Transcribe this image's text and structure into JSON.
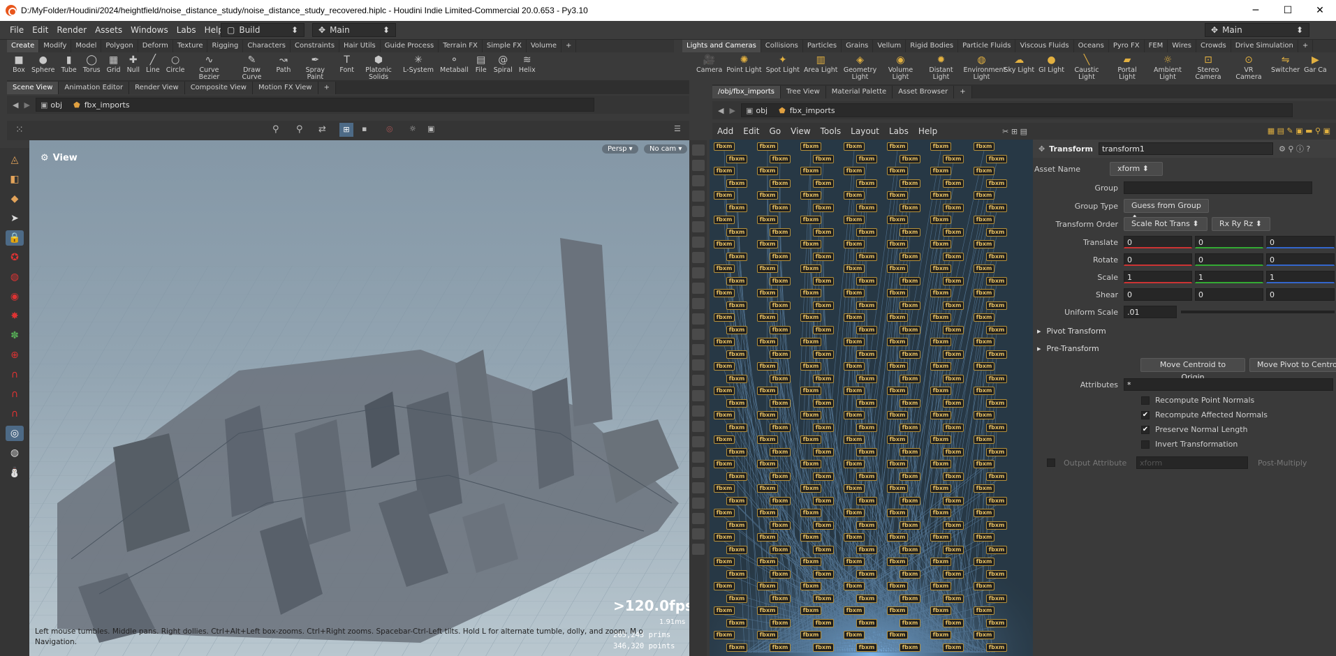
{
  "window": {
    "title": "D:/MyFolder/Houdini/2024/heightfield/noise_distance_study/noise_distance_study_recovered.hiplc - Houdini Indie Limited-Commercial 20.0.653 - Py3.10",
    "min": "─",
    "max": "☐",
    "close": "✕"
  },
  "menu": [
    "File",
    "Edit",
    "Render",
    "Assets",
    "Windows",
    "Labs",
    "Help"
  ],
  "desktop": "Build",
  "main_left": "Main",
  "main_right": "Main",
  "shelf_left_tabs": [
    "Create",
    "Modify",
    "Model",
    "Polygon",
    "Deform",
    "Texture",
    "Rigging",
    "Characters",
    "Constraints",
    "Hair Utils",
    "Guide Process",
    "Terrain FX",
    "Simple FX",
    "Volume",
    "+"
  ],
  "shelf_left_tools": [
    [
      "Box",
      "■"
    ],
    [
      "Sphere",
      "●"
    ],
    [
      "Tube",
      "▮"
    ],
    [
      "Torus",
      "◯"
    ],
    [
      "Grid",
      "▦"
    ],
    [
      "Null",
      "✚"
    ],
    [
      "Line",
      "╱"
    ],
    [
      "Circle",
      "○"
    ],
    [
      "Curve Bezier",
      "∿"
    ],
    [
      "Draw Curve",
      "✎"
    ],
    [
      "Path",
      "↝"
    ],
    [
      "Spray Paint",
      "✒"
    ],
    [
      "Font",
      "T"
    ],
    [
      "Platonic Solids",
      "⬢"
    ],
    [
      "L-System",
      "✳"
    ],
    [
      "Metaball",
      "⚬"
    ],
    [
      "File",
      "▤"
    ],
    [
      "Spiral",
      "@"
    ],
    [
      "Helix",
      "≋"
    ]
  ],
  "shelf_right_tabs": [
    "Lights and Cameras",
    "Collisions",
    "Particles",
    "Grains",
    "Vellum",
    "Rigid Bodies",
    "Particle Fluids",
    "Viscous Fluids",
    "Oceans",
    "Pyro FX",
    "FEM",
    "Wires",
    "Crowds",
    "Drive Simulation",
    "+"
  ],
  "shelf_right_tools": [
    [
      "Camera",
      "🎥"
    ],
    [
      "Point Light",
      "✺"
    ],
    [
      "Spot Light",
      "✦"
    ],
    [
      "Area Light",
      "▥"
    ],
    [
      "Geometry Light",
      "◈"
    ],
    [
      "Volume Light",
      "◉"
    ],
    [
      "Distant Light",
      "✹"
    ],
    [
      "Environment Light",
      "◍"
    ],
    [
      "Sky Light",
      "☁"
    ],
    [
      "GI Light",
      "●"
    ],
    [
      "Caustic Light",
      "╲"
    ],
    [
      "Portal Light",
      "▰"
    ],
    [
      "Ambient Light",
      "☼"
    ],
    [
      "Stereo Camera",
      "⊡"
    ],
    [
      "VR Camera",
      "⊙"
    ],
    [
      "Switcher",
      "⇋"
    ],
    [
      "Gar Ca",
      "▶"
    ]
  ],
  "left_pane_tabs": [
    "Scene View",
    "Animation Editor",
    "Render View",
    "Composite View",
    "Motion FX View",
    "+"
  ],
  "right_pane_tabs": [
    "/obj/fbx_imports",
    "Tree View",
    "Material Palette",
    "Asset Browser",
    "+"
  ],
  "path_obj": "obj",
  "path_node": "fbx_imports",
  "viewport": {
    "name": "View",
    "persp": "Persp",
    "cam": "No cam",
    "fps": ">120.0fps",
    "ms": "1.91ms",
    "prims": "265,243  prims",
    "points": "346,320 points",
    "help": "Left mouse tumbles. Middle pans. Right dollies. Ctrl+Alt+Left box-zooms. Ctrl+Right zooms. Spacebar-Ctrl-Left tilts. Hold L for alternate tumble, dolly, and zoom. M or Alt+M for First Person",
    "help2": "Navigation."
  },
  "net_menu": [
    "Add",
    "Edit",
    "Go",
    "View",
    "Tools",
    "Layout",
    "Labs",
    "Help"
  ],
  "node_label": "fbxm",
  "params": {
    "type": "Transform",
    "name": "transform1",
    "asset_label": "Asset Name",
    "asset": "xform",
    "group_label": "Group",
    "group": "",
    "grouptype_label": "Group Type",
    "grouptype": "Guess from Group",
    "order_label": "Transform Order",
    "order": "Scale Rot Trans",
    "rot_order": "Rx Ry Rz",
    "translate_label": "Translate",
    "translate": [
      "0",
      "0",
      "0"
    ],
    "rotate_label": "Rotate",
    "rotate": [
      "0",
      "0",
      "0"
    ],
    "scale_label": "Scale",
    "scale": [
      "1",
      "1",
      "1"
    ],
    "shear_label": "Shear",
    "shear": [
      "0",
      "0",
      "0"
    ],
    "uscale_label": "Uniform Scale",
    "uscale": ".01",
    "pivot": "Pivot Transform",
    "pre": "Pre-Transform",
    "move_centroid": "Move Centroid to Origin",
    "move_pivot": "Move Pivot to Centroid",
    "attr_label": "Attributes",
    "attr": "*",
    "c1": "Recompute Point Normals",
    "c2": "Recompute Affected Normals",
    "c3": "Preserve Normal Length",
    "c4": "Invert Transformation",
    "outattr_label": "Output Attribute",
    "outattr": "xform",
    "post": "Post-Multiply"
  }
}
